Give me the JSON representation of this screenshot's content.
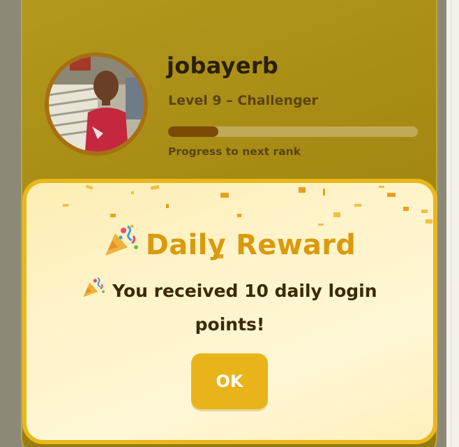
{
  "profile": {
    "username": "jobayerb",
    "level_label": "Level 9 – Challenger",
    "progress": 0.2,
    "progress_caption": "Progress to next rank"
  },
  "modal": {
    "title": "Daily Reward",
    "message": "You received 10 daily login points!",
    "ok_label": "OK"
  },
  "icons": {
    "title_icon": "party-popper-icon",
    "message_icon": "party-popper-icon"
  },
  "colors": {
    "accent": "#e8b41a",
    "title": "#d99a0c",
    "progress_fill": "#7a4a06"
  }
}
